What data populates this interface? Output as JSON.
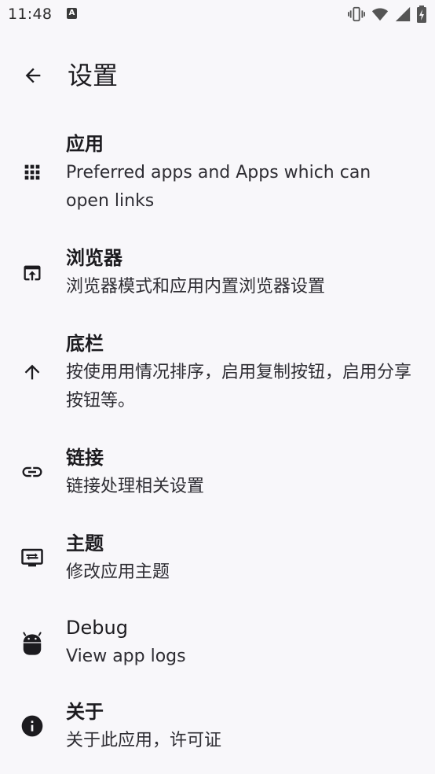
{
  "status_bar": {
    "time": "11:48",
    "notification_letter": "A",
    "icons": [
      "vibrate-icon",
      "wifi-icon",
      "signal-icon",
      "battery-charging-icon"
    ]
  },
  "app_bar": {
    "back_icon": "arrow-back-icon",
    "title": "设置"
  },
  "settings": [
    {
      "id": "apps",
      "icon": "apps-grid-icon",
      "title": "应用",
      "summary": "Preferred apps and Apps which can open links"
    },
    {
      "id": "browser",
      "icon": "open-in-browser-icon",
      "title": "浏览器",
      "summary": "浏览器模式和应用内置浏览器设置"
    },
    {
      "id": "bottom-bar",
      "icon": "arrow-upward-icon",
      "title": "底栏",
      "summary": "按使用用情况排序，启用复制按钮，启用分享按钮等。"
    },
    {
      "id": "links",
      "icon": "link-icon",
      "title": "链接",
      "summary": "链接处理相关设置"
    },
    {
      "id": "theme",
      "icon": "theme-icon",
      "title": "主题",
      "summary": "修改应用主题"
    },
    {
      "id": "debug",
      "icon": "android-icon",
      "title": "Debug",
      "summary": "View app logs"
    },
    {
      "id": "about",
      "icon": "info-icon",
      "title": "关于",
      "summary": "关于此应用，许可证"
    }
  ],
  "colors": {
    "background": "#f8f7fa",
    "icon": "#1c1b1f",
    "text": "#1c1b1f"
  }
}
